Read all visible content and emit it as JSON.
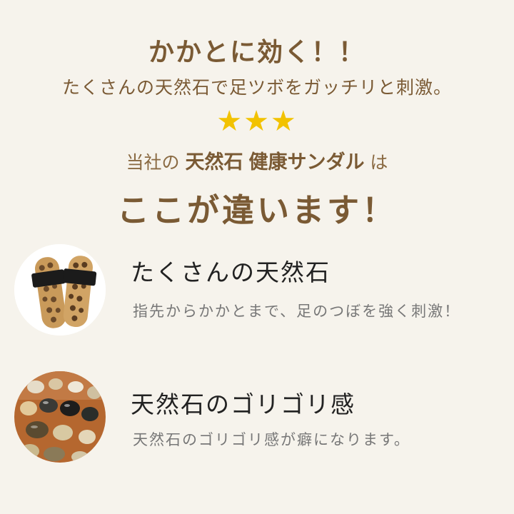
{
  "header": {
    "headline": "かかとに効く！！",
    "subline": "たくさんの天然石で足ツボをガッチリと刺激。",
    "stars": "★★★",
    "company_prefix": "当社の",
    "company_product_stone": "天然石",
    "company_product_sandal": "健康サンダル",
    "company_suffix": "は",
    "difference": "ここが違います！"
  },
  "features": [
    {
      "title": "たくさんの天然石",
      "description": "指先からかかとまで、足のつぼを強く刺激！",
      "image": "sandal-photo"
    },
    {
      "title": "天然石のゴリゴリ感",
      "description": "天然石のゴリゴリ感が癖になります。",
      "image": "stones-closeup-photo"
    }
  ],
  "colors": {
    "background": "#f6f3ec",
    "heading": "#7a5a34",
    "star": "#f2c200",
    "title": "#222222",
    "description": "#777777"
  }
}
